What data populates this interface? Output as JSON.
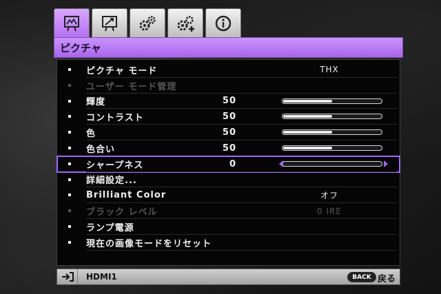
{
  "tabs": [
    {
      "icon": "picture-icon",
      "active": true
    },
    {
      "icon": "presentation-icon",
      "active": false
    },
    {
      "icon": "settings-basic-icon",
      "active": false
    },
    {
      "icon": "settings-advanced-icon",
      "active": false
    },
    {
      "icon": "info-icon",
      "active": false
    }
  ],
  "title": "ピクチャ",
  "rows": [
    {
      "label": "ピクチャ モード",
      "value": "THX",
      "disabled": false
    },
    {
      "label": "ユーザー モード管理",
      "disabled": true
    },
    {
      "label": "輝度",
      "num": "50",
      "level": 0.5,
      "disabled": false
    },
    {
      "label": "コントラスト",
      "num": "50",
      "level": 0.5,
      "disabled": false
    },
    {
      "label": "色",
      "num": "50",
      "level": 0.5,
      "disabled": false
    },
    {
      "label": "色合い",
      "num": "50",
      "level": 0.5,
      "disabled": false
    },
    {
      "label": "シャープネス",
      "num": "0",
      "level": 0.0,
      "disabled": false,
      "selected": true
    },
    {
      "label": "詳細設定...",
      "disabled": false
    },
    {
      "label": "Brilliant Color",
      "value": "オフ",
      "disabled": false
    },
    {
      "label": "ブラック レベル",
      "value": "0 IRE",
      "disabled": true
    },
    {
      "label": "ランプ電源",
      "disabled": false
    },
    {
      "label": "現在の画像モードをリセット",
      "disabled": false
    }
  ],
  "footer": {
    "source": "HDMI1",
    "back_button": "BACK",
    "back_label": "戻る"
  },
  "colors": {
    "accent": "#a465ff",
    "title_bar": "#b67af0"
  }
}
